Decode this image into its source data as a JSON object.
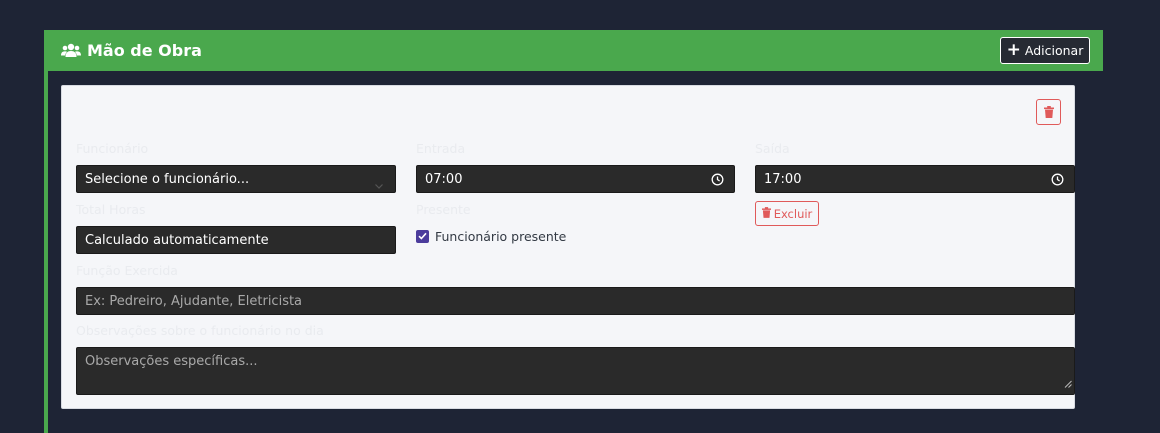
{
  "section": {
    "title": "Mão de Obra",
    "add_label": "Adicionar"
  },
  "form": {
    "funcionario": {
      "label": "Funcionário",
      "value": "Selecione o funcionário..."
    },
    "entrada": {
      "label": "Entrada",
      "value": "07:00"
    },
    "saida": {
      "label": "Saída",
      "value": "17:00"
    },
    "total_horas": {
      "label": "Total Horas",
      "value": "Calculado automaticamente"
    },
    "presente": {
      "label": "Presente",
      "checkbox_label": "Funcionário presente",
      "checked": true
    },
    "funcao": {
      "label": "Função Exercida",
      "placeholder": "Ex: Pedreiro, Ajudante, Eletricista"
    },
    "observacoes": {
      "label": "Observações sobre o funcionário no dia",
      "placeholder": "Observações específicas..."
    },
    "excluir_label": "Excluir"
  },
  "colors": {
    "header_green": "#4aa84d",
    "danger": "#e05a5a",
    "checkbox": "#4b3c9c",
    "page_bg": "#1e2435"
  },
  "icons": {
    "title": "users-icon",
    "add": "plus-icon",
    "delete": "trash-icon",
    "time": "clock-icon"
  }
}
